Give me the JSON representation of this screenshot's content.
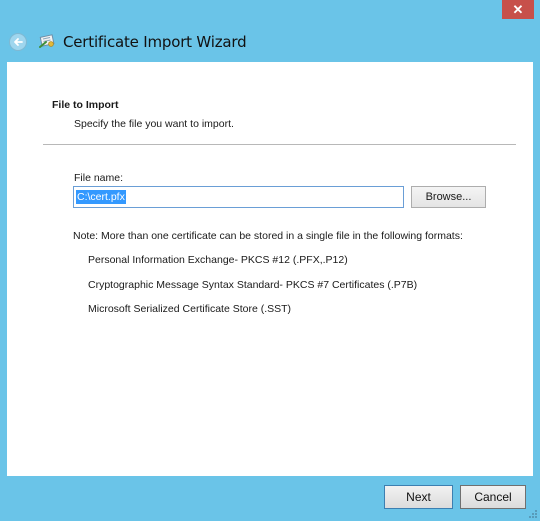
{
  "window": {
    "title": "Certificate Import Wizard",
    "close_label": "✕"
  },
  "page": {
    "section_title": "File to Import",
    "section_description": "Specify the file you want to import.",
    "file_name_label": "File name:",
    "file_name_value": "C:\\cert.pfx",
    "browse_label": "Browse...",
    "note": "Note:  More than one certificate can be stored in a single file in the following formats:",
    "formats": [
      "Personal Information Exchange- PKCS #12 (.PFX,.P12)",
      "Cryptographic Message Syntax Standard- PKCS #7 Certificates (.P7B)",
      "Microsoft Serialized Certificate Store (.SST)"
    ]
  },
  "footer": {
    "next_label": "Next",
    "cancel_label": "Cancel"
  },
  "icons": {
    "back": "back-arrow-icon",
    "wizard": "certificate-wizard-icon",
    "close": "close-icon"
  },
  "colors": {
    "chrome": "#6ac4e8",
    "close_button": "#c7504a",
    "selection": "#3399ff"
  }
}
